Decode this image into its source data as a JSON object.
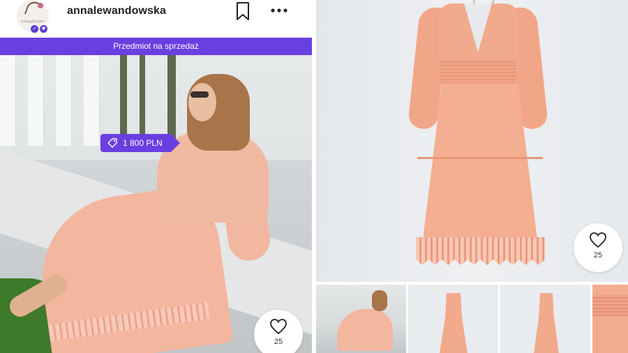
{
  "profile": {
    "username": "annalewandowska",
    "avatar_text": "babyglarlyne"
  },
  "post": {
    "sale_banner": "Przedmiot na sprzedaż",
    "price": "1 800 PLN",
    "likes_left": "25",
    "likes_right": "25"
  },
  "icons": {
    "bookmark": "bookmark-icon",
    "more": "more-icon",
    "tag": "tag-icon",
    "heart": "heart-icon",
    "verified": "verified-badge-icon",
    "settings": "gear-badge-icon"
  },
  "colors": {
    "accent": "#6a3fe0",
    "dress": "#f2aa8c"
  }
}
